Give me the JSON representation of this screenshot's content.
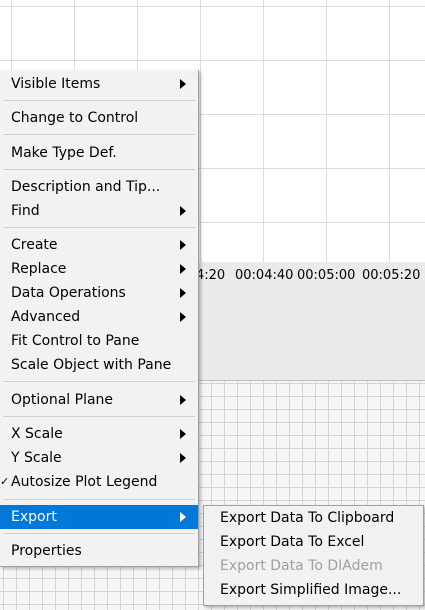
{
  "graph": {
    "x_ticks": [
      "4:20",
      "00:04:40",
      "00:05:00",
      "00:05:20"
    ]
  },
  "context_menu": {
    "items": [
      {
        "label": "Visible Items",
        "submenu": true
      },
      {
        "label": "Change to Control",
        "submenu": false
      },
      {
        "label": "Make Type Def.",
        "submenu": false
      },
      {
        "label": "Description and Tip...",
        "submenu": false
      },
      {
        "label": "Find",
        "submenu": true
      },
      {
        "label": "Create",
        "submenu": true
      },
      {
        "label": "Replace",
        "submenu": true
      },
      {
        "label": "Data Operations",
        "submenu": true
      },
      {
        "label": "Advanced",
        "submenu": true
      },
      {
        "label": "Fit Control to Pane",
        "submenu": false
      },
      {
        "label": "Scale Object with Pane",
        "submenu": false
      },
      {
        "label": "Optional Plane",
        "submenu": true
      },
      {
        "label": "X Scale",
        "submenu": true
      },
      {
        "label": "Y Scale",
        "submenu": true
      },
      {
        "label": "Autosize Plot Legend",
        "submenu": false,
        "checked": true,
        "check_mark": "✓"
      },
      {
        "label": "Export",
        "submenu": true,
        "highlighted": true
      },
      {
        "label": "Properties",
        "submenu": false
      }
    ],
    "highlight_color": "#0078d7"
  },
  "export_submenu": {
    "items": [
      {
        "label": "Export Data To Clipboard",
        "enabled": true
      },
      {
        "label": "Export Data To Excel",
        "enabled": true
      },
      {
        "label": "Export Data To DIAdem",
        "enabled": false
      },
      {
        "label": "Export Simplified Image...",
        "enabled": true
      }
    ]
  }
}
